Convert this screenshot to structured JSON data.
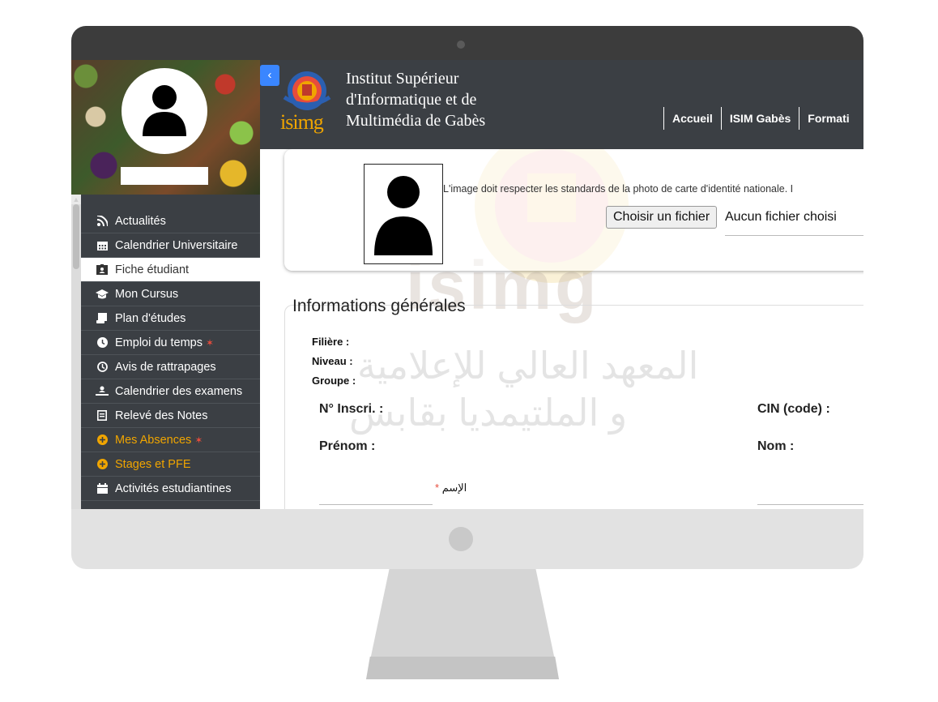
{
  "header": {
    "institute_lines": [
      "Institut Supérieur",
      "d'Informatique et de",
      "Multimédia de Gabès"
    ],
    "logo_text": "isimg",
    "nav": [
      "Accueil",
      "ISIM Gabès",
      "Formati"
    ]
  },
  "sidebar": {
    "collapse_icon": "chevron-left-icon",
    "items": [
      {
        "label": "Actualités",
        "icon": "rss-icon"
      },
      {
        "label": "Calendrier Universitaire",
        "icon": "calendar-icon"
      },
      {
        "label": "Fiche étudiant",
        "icon": "id-card-icon",
        "active": true
      },
      {
        "label": "Mon Cursus",
        "icon": "graduation-cap-icon"
      },
      {
        "label": "Plan d'études",
        "icon": "scroll-icon"
      },
      {
        "label": "Emploi du temps",
        "icon": "clock-icon",
        "badge": true
      },
      {
        "label": "Avis de rattrapages",
        "icon": "clock-outline-icon"
      },
      {
        "label": "Calendrier des examens",
        "icon": "exam-icon"
      },
      {
        "label": "Relevé des Notes",
        "icon": "document-icon"
      },
      {
        "label": "Mes Absences",
        "icon": "plus-circle-icon",
        "accent": true,
        "badge": true
      },
      {
        "label": "Stages et PFE",
        "icon": "plus-circle-icon",
        "accent": true
      },
      {
        "label": "Activités estudiantines",
        "icon": "calendar-check-icon"
      }
    ]
  },
  "photo": {
    "hint": "L'image doit respecter les standards de la photo de carte d'identité nationale. I",
    "file_button": "Choisir un fichier",
    "file_status": "Aucun fichier choisi"
  },
  "info": {
    "section_title": "Informations générales",
    "filiere": "Filière :",
    "niveau": "Niveau :",
    "groupe": "Groupe :",
    "inscri": "N° Inscri. :",
    "cin": "CIN (code) :",
    "prenom": "Prénom :",
    "nom": "Nom :",
    "arabic_name": "الإسم",
    "required_mark": "*"
  },
  "watermark": {
    "text": "isimg",
    "arabic_line1": "المعهد العالي للإعلامية",
    "arabic_line2": "و الملتيمديا بقابس"
  },
  "colors": {
    "sidebar_bg": "#3b3f44",
    "accent": "#f0a500",
    "badge": "#e74c3c",
    "collapse": "#3a86ff"
  }
}
